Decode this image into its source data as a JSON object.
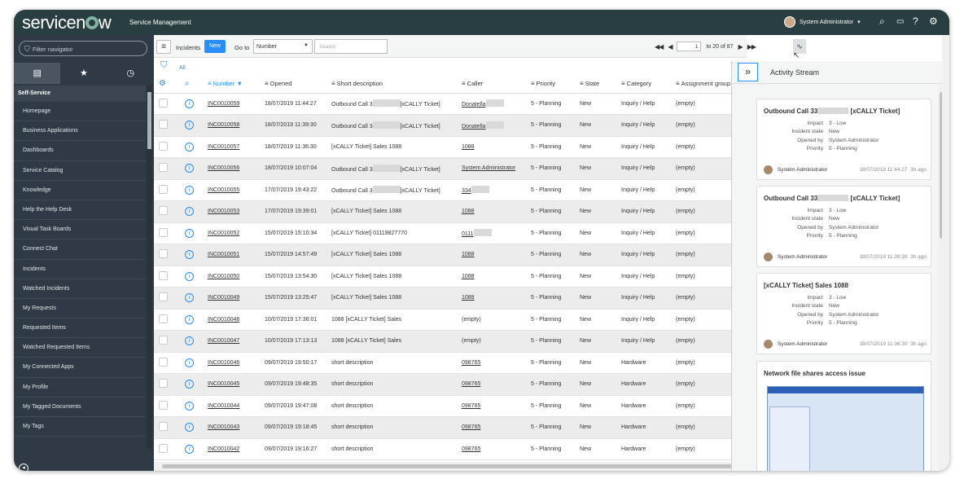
{
  "topbar": {
    "logo": "servicenow",
    "app_name": "Service Management",
    "user_name": "System Administrator",
    "icons": [
      "search-icon",
      "chat-icon",
      "help-icon",
      "gear-icon"
    ]
  },
  "nav": {
    "filter_placeholder": "Filter navigator",
    "tabs": [
      "list-icon",
      "star-icon",
      "history-icon"
    ],
    "section": "Self-Service",
    "items": [
      "Homepage",
      "Business Applications",
      "Dashboards",
      "Service Catalog",
      "Knowledge",
      "Help the Help Desk",
      "Visual Task Boards",
      "Connect Chat",
      "Incidents",
      "Watched Incidents",
      "My Requests",
      "Requested Items",
      "Watched Requested Items",
      "My Connected Apps",
      "My Profile",
      "My Tagged Documents",
      "My Tags"
    ]
  },
  "list": {
    "title": "Incidents",
    "new_label": "New",
    "goto_label": "Go to",
    "field_value": "Number",
    "search_placeholder": "Search",
    "filter_all": "All",
    "pager": {
      "page": "1",
      "range": "to 20 of 87"
    },
    "columns": [
      "Number",
      "Opened",
      "Short description",
      "Caller",
      "Priority",
      "State",
      "Category",
      "Assignment group"
    ],
    "rows": [
      {
        "number": "INC0010059",
        "opened": "18/07/2019 11:44:27",
        "desc": "Outbound Call 3",
        "desc2": "[xCALLY Ticket]",
        "caller": "Donatella",
        "priority": "5 - Planning",
        "state": "New",
        "category": "Inquiry / Help",
        "group": "(empty)"
      },
      {
        "number": "INC0010058",
        "opened": "18/07/2019 11:39:30",
        "desc": "Outbound Call 3",
        "desc2": "[xCALLY Ticket]",
        "caller": "Donatella",
        "priority": "5 - Planning",
        "state": "New",
        "category": "Inquiry / Help",
        "group": "(empty)"
      },
      {
        "number": "INC0010057",
        "opened": "18/07/2019 11:36:30",
        "desc": "[xCALLY Ticket] Sales 1088",
        "desc2": "",
        "caller": "1088",
        "priority": "5 - Planning",
        "state": "New",
        "category": "Inquiry / Help",
        "group": "(empty)"
      },
      {
        "number": "INC0010056",
        "opened": "18/07/2019 10:07:04",
        "desc": "Outbound Call 3",
        "desc2": "[xCALLY Ticket]",
        "caller": "System Administrator",
        "priority": "5 - Planning",
        "state": "New",
        "category": "Inquiry / Help",
        "group": "(empty)"
      },
      {
        "number": "INC0010055",
        "opened": "17/07/2019 19:43:22",
        "desc": "Outbound Call 3",
        "desc2": "[xCALLY Ticket]",
        "caller": "334",
        "priority": "5 - Planning",
        "state": "New",
        "category": "Inquiry / Help",
        "group": "(empty)"
      },
      {
        "number": "INC0010053",
        "opened": "17/07/2019 19:39:01",
        "desc": "[xCALLY Ticket] Sales 1088",
        "desc2": "",
        "caller": "1088",
        "priority": "5 - Planning",
        "state": "New",
        "category": "Inquiry / Help",
        "group": "(empty)"
      },
      {
        "number": "INC0010052",
        "opened": "15/07/2019 15:10:34",
        "desc": "[xCALLY Ticket] 01119827770",
        "desc2": "",
        "caller": "0111",
        "priority": "5 - Planning",
        "state": "New",
        "category": "Inquiry / Help",
        "group": "(empty)"
      },
      {
        "number": "INC0010051",
        "opened": "15/07/2019 14:57:49",
        "desc": "[xCALLY Ticket] Sales 1088",
        "desc2": "",
        "caller": "1088",
        "priority": "5 - Planning",
        "state": "New",
        "category": "Inquiry / Help",
        "group": "(empty)"
      },
      {
        "number": "INC0010050",
        "opened": "15/07/2019 13:54:30",
        "desc": "[xCALLY Ticket] Sales 1088",
        "desc2": "",
        "caller": "1088",
        "priority": "5 - Planning",
        "state": "New",
        "category": "Inquiry / Help",
        "group": "(empty)"
      },
      {
        "number": "INC0010049",
        "opened": "15/07/2019 13:25:47",
        "desc": "[xCALLY Ticket] Sales 1088",
        "desc2": "",
        "caller": "1088",
        "priority": "5 - Planning",
        "state": "New",
        "category": "Inquiry / Help",
        "group": "(empty)"
      },
      {
        "number": "INC0010048",
        "opened": "10/07/2019 17:36:01",
        "desc": "1088 [xCALLY Ticket] Sales",
        "desc2": "",
        "caller": "(empty)",
        "priority": "5 - Planning",
        "state": "New",
        "category": "Inquiry / Help",
        "group": "(empty)"
      },
      {
        "number": "INC0010047",
        "opened": "10/07/2019 17:13:13",
        "desc": "1088 [xCALLY Ticket] Sales",
        "desc2": "",
        "caller": "(empty)",
        "priority": "5 - Planning",
        "state": "New",
        "category": "Inquiry / Help",
        "group": "(empty)"
      },
      {
        "number": "INC0010046",
        "opened": "09/07/2019 19:50:17",
        "desc": "short description",
        "desc2": "",
        "caller": "098765",
        "priority": "5 - Planning",
        "state": "New",
        "category": "Hardware",
        "group": "(empty)"
      },
      {
        "number": "INC0010045",
        "opened": "09/07/2019 19:48:35",
        "desc": "short description",
        "desc2": "",
        "caller": "098765",
        "priority": "5 - Planning",
        "state": "New",
        "category": "Hardware",
        "group": "(empty)"
      },
      {
        "number": "INC0010044",
        "opened": "09/07/2019 19:47:08",
        "desc": "short description",
        "desc2": "",
        "caller": "098765",
        "priority": "5 - Planning",
        "state": "New",
        "category": "Hardware",
        "group": "(empty)"
      },
      {
        "number": "INC0010043",
        "opened": "09/07/2019 19:18:45",
        "desc": "short description",
        "desc2": "",
        "caller": "098765",
        "priority": "5 - Planning",
        "state": "New",
        "category": "Hardware",
        "group": "(empty)"
      },
      {
        "number": "INC0010042",
        "opened": "09/07/2019 19:16:27",
        "desc": "short description",
        "desc2": "",
        "caller": "098765",
        "priority": "5 - Planning",
        "state": "New",
        "category": "Hardware",
        "group": "(empty)"
      }
    ]
  },
  "activity": {
    "title": "Activity Stream",
    "labels": {
      "impact": "Impact",
      "incident_state": "Incident state",
      "opened_by": "Opened by",
      "priority": "Priority"
    },
    "cards": [
      {
        "title_a": "Outbound Call 33",
        "title_b": "[xCALLY Ticket]",
        "impact": "3 - Low",
        "state": "New",
        "opened_by": "System Administrator",
        "priority": "5 - Planning",
        "author": "System Administrator",
        "time": "18/07/2019 11:44:27",
        "ago": "3h ago"
      },
      {
        "title_a": "Outbound Call 33",
        "title_b": "[xCALLY Ticket]",
        "impact": "3 - Low",
        "state": "New",
        "opened_by": "System Administrator",
        "priority": "5 - Planning",
        "author": "System Administrator",
        "time": "18/07/2019 11:39:30",
        "ago": "3h ago"
      },
      {
        "title_a": "[xCALLY Ticket] Sales 1088",
        "title_b": "",
        "impact": "3 - Low",
        "state": "New",
        "opened_by": "System Administrator",
        "priority": "5 - Planning",
        "author": "System Administrator",
        "time": "18/07/2019 11:36:30",
        "ago": "3h ago"
      }
    ],
    "last_card_title": "Network file shares access issue"
  }
}
